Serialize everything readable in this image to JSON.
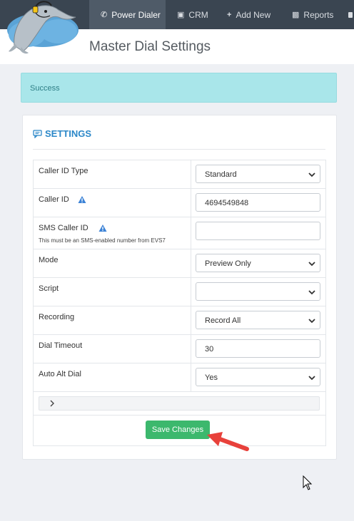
{
  "nav": {
    "items": [
      {
        "label": "Power Dialer",
        "icon": "phone-icon",
        "active": true
      },
      {
        "label": "CRM",
        "icon": "book-icon",
        "active": false
      },
      {
        "label": "Add New",
        "icon": "plus-icon",
        "active": false
      },
      {
        "label": "Reports",
        "icon": "report-icon",
        "active": false
      }
    ]
  },
  "header": {
    "title": "Master Dial Settings"
  },
  "alert": {
    "text": "Success"
  },
  "settings": {
    "title": "SETTINGS",
    "icon": "comment-icon",
    "rows": [
      {
        "label": "Caller ID Type",
        "type": "select",
        "value": "Standard"
      },
      {
        "label": "Caller ID",
        "type": "input",
        "value": "4694549848",
        "warning": true
      },
      {
        "label": "SMS Caller ID",
        "sublabel": "This must be an SMS-enabled number from EVS7",
        "type": "input",
        "value": "",
        "warning": true
      },
      {
        "label": "Mode",
        "type": "select",
        "value": "Preview Only"
      },
      {
        "label": "Script",
        "type": "select",
        "value": ""
      },
      {
        "label": "Recording",
        "type": "select",
        "value": "Record All"
      },
      {
        "label": "Dial Timeout",
        "type": "input",
        "value": "30"
      },
      {
        "label": "Auto Alt Dial",
        "type": "select",
        "value": "Yes"
      }
    ],
    "save_label": "Save Changes"
  },
  "colors": {
    "nav_bg": "#3a4551",
    "nav_active": "#4f5b68",
    "accent": "#2b87c8",
    "success_bg": "#a9e6ea",
    "save_button": "#3cb86d",
    "annotation_arrow": "#e8413b",
    "warning_icon": "#3b82d6"
  }
}
